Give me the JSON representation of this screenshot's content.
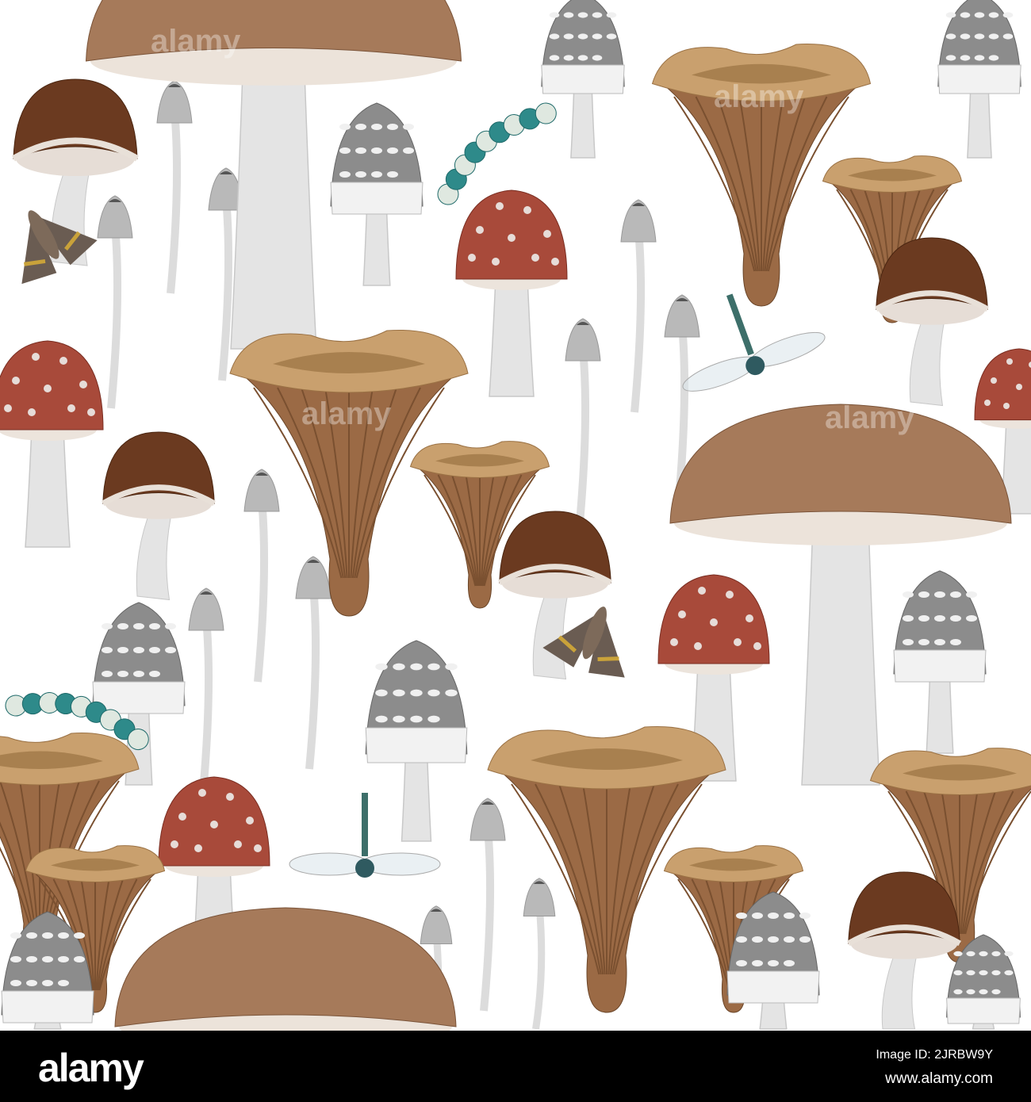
{
  "image": {
    "subject": "seamless mushroom pattern",
    "palette": {
      "chanterelle": "#c9a06e",
      "agaric": "#a84a3a",
      "bolete": "#6b3a20",
      "inkcap": "#8c8c8c",
      "bigcap": "#a67a5a",
      "stem": "#e4e4e4"
    }
  },
  "watermark": {
    "logo": "alamy"
  },
  "footer": {
    "logo": "alamy",
    "image_id": "Image ID: 2JRBW9Y",
    "site": "www.alamy.com"
  }
}
